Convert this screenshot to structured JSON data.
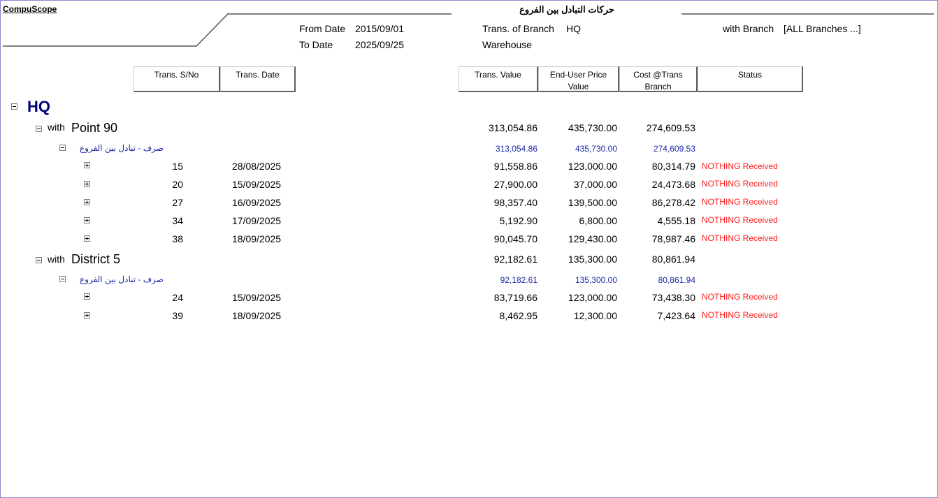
{
  "app": {
    "brand": "CompuScope",
    "title": "حركات التبادل بين الفروع"
  },
  "header": {
    "from_date_label": "From Date",
    "from_date": "2015/09/01",
    "to_date_label": "To Date",
    "to_date": "2025/09/25",
    "trans_branch_label": "Trans. of Branch",
    "trans_branch": "HQ",
    "warehouse_label": "Warehouse",
    "with_branch_label": "with Branch",
    "with_branch": "[ALL Branches ...]"
  },
  "columns": {
    "sno": "Trans. S/No",
    "date": "Trans. Date",
    "value": "Trans. Value",
    "enduser_1": "End-User Price",
    "enduser_2": "Value",
    "cost_1": "Cost @Trans",
    "cost_2": "Branch",
    "status": "Status"
  },
  "groups": {
    "root": "HQ",
    "g1": {
      "with": "with",
      "branch": "Point 90",
      "value": "313,054.86",
      "enduser": "435,730.00",
      "cost": "274,609.53",
      "type_label": "صرف - تبادل بين الفروع",
      "type_value": "313,054.86",
      "type_enduser": "435,730.00",
      "type_cost": "274,609.53",
      "rows": [
        {
          "sno": "15",
          "date": "28/08/2025",
          "value": "91,558.86",
          "enduser": "123,000.00",
          "cost": "80,314.79",
          "status": "NOTHING Received"
        },
        {
          "sno": "20",
          "date": "15/09/2025",
          "value": "27,900.00",
          "enduser": "37,000.00",
          "cost": "24,473.68",
          "status": "NOTHING Received"
        },
        {
          "sno": "27",
          "date": "16/09/2025",
          "value": "98,357.40",
          "enduser": "139,500.00",
          "cost": "86,278.42",
          "status": "NOTHING Received"
        },
        {
          "sno": "34",
          "date": "17/09/2025",
          "value": "5,192.90",
          "enduser": "6,800.00",
          "cost": "4,555.18",
          "status": "NOTHING Received"
        },
        {
          "sno": "38",
          "date": "18/09/2025",
          "value": "90,045.70",
          "enduser": "129,430.00",
          "cost": "78,987.46",
          "status": "NOTHING Received"
        }
      ]
    },
    "g2": {
      "with": "with",
      "branch": "District 5",
      "value": "92,182.61",
      "enduser": "135,300.00",
      "cost": "80,861.94",
      "type_label": "صرف - تبادل بين الفروع",
      "type_value": "92,182.61",
      "type_enduser": "135,300.00",
      "type_cost": "80,861.94",
      "rows": [
        {
          "sno": "24",
          "date": "15/09/2025",
          "value": "83,719.66",
          "enduser": "123,000.00",
          "cost": "73,438.30",
          "status": "NOTHING Received"
        },
        {
          "sno": "39",
          "date": "18/09/2025",
          "value": "8,462.95",
          "enduser": "12,300.00",
          "cost": "7,423.64",
          "status": "NOTHING Received"
        }
      ]
    }
  }
}
